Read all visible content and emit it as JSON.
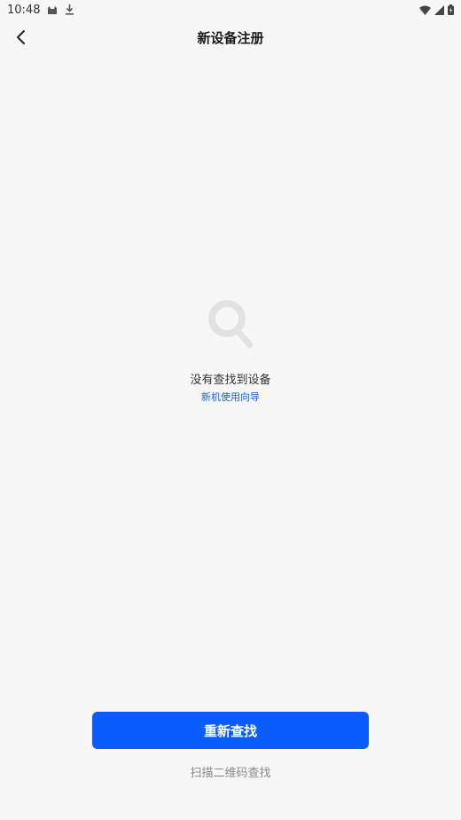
{
  "status_bar": {
    "time": "10:48",
    "icons": [
      "cat-icon",
      "download-icon",
      "wifi-icon",
      "signal-icon",
      "battery-icon"
    ]
  },
  "header": {
    "title": "新设备注册",
    "back_icon": "chevron-left-icon"
  },
  "empty_state": {
    "icon": "magnifier-icon",
    "message": "没有查找到设备",
    "guide_link": "新机使用向导"
  },
  "actions": {
    "primary_label": "重新查找",
    "secondary_label": "扫描二维码查找"
  },
  "colors": {
    "accent": "#0a5cff",
    "link": "#1a5fd6",
    "background": "#f7f7f8",
    "muted_text": "#888888",
    "icon_gray": "#e2e2e4"
  }
}
